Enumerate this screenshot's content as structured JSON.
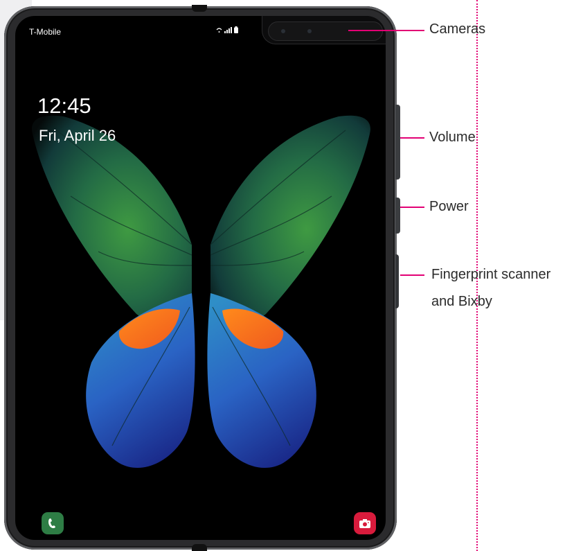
{
  "lockscreen": {
    "carrier": "T-Mobile",
    "time": "12:45",
    "date": "Fri, April 26",
    "status_icons": [
      "wifi-icon",
      "signal-icon",
      "battery-icon"
    ]
  },
  "apps": {
    "phone_icon": "phone-icon",
    "camera_icon": "camera-icon"
  },
  "callouts": {
    "cameras": "Cameras",
    "volume": "Volume",
    "power": "Power",
    "fingerprint_line1": "Fingerprint scanner",
    "fingerprint_line2": "and Bixby"
  },
  "colors": {
    "accent": "#e20074",
    "phone_app": "#2e7d45",
    "camera_app": "#d81b3c"
  }
}
